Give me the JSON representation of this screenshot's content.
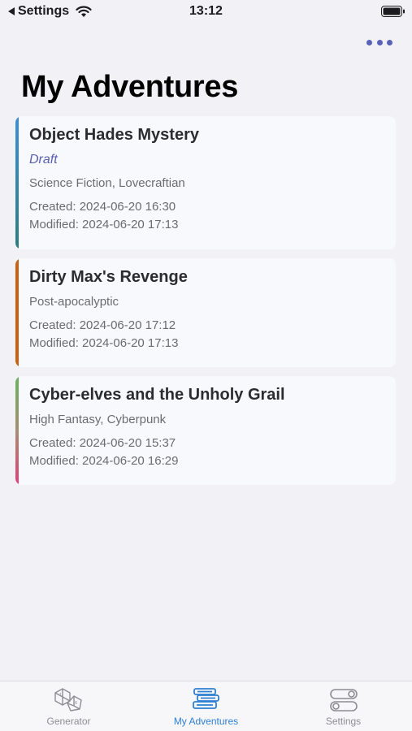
{
  "status_bar": {
    "back_label": "Settings",
    "time": "13:12"
  },
  "header": {
    "title": "My Adventures"
  },
  "adventures": [
    {
      "title": "Object Hades Mystery",
      "status": "Draft",
      "genres": "Science Fiction, Lovecraftian",
      "created": "Created: 2024-06-20 16:30",
      "modified": "Modified: 2024-06-20 17:13"
    },
    {
      "title": "Dirty Max's Revenge",
      "genres": "Post-apocalyptic",
      "created": "Created: 2024-06-20 17:12",
      "modified": "Modified: 2024-06-20 17:13"
    },
    {
      "title": "Cyber-elves and the Unholy Grail",
      "genres": "High Fantasy, Cyberpunk",
      "created": "Created: 2024-06-20 15:37",
      "modified": "Modified: 2024-06-20 16:29"
    }
  ],
  "tabs": [
    {
      "label": "Generator",
      "icon": "dice-icon"
    },
    {
      "label": "My Adventures",
      "icon": "books-icon",
      "active": true
    },
    {
      "label": "Settings",
      "icon": "toggles-icon"
    }
  ],
  "colors": {
    "accent": "#2f7fd2",
    "draft": "#5a5fae",
    "more_dots": "#5a62b8"
  }
}
